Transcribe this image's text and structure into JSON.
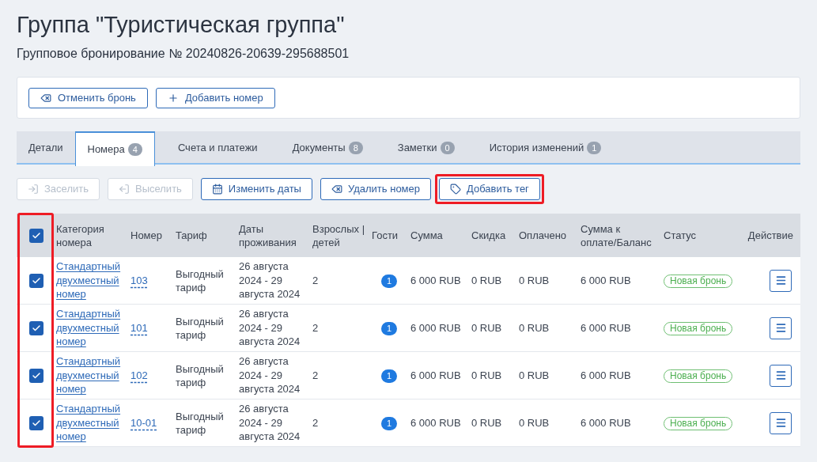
{
  "title": "Группа \"Туристическая группа\"",
  "subtitle": "Групповое бронирование № 20240826-20639-295688501",
  "actions": [
    {
      "label": "Отменить бронь"
    },
    {
      "label": "Добавить номер"
    }
  ],
  "tabs": [
    {
      "label": "Детали",
      "selected": false
    },
    {
      "label": "Номера",
      "count": "4",
      "selected": true
    },
    {
      "label": "Счета и платежи",
      "selected": false
    },
    {
      "label": "Документы",
      "count": "8",
      "selected": false
    },
    {
      "label": "Заметки",
      "count": "0",
      "selected": false
    },
    {
      "label": "История изменений",
      "count": "1",
      "selected": false
    }
  ],
  "toolbar": [
    {
      "label": "Заселить",
      "disabled": true,
      "highlighted": false
    },
    {
      "label": "Выселить",
      "disabled": true,
      "highlighted": false
    },
    {
      "label": "Изменить даты",
      "disabled": false,
      "highlighted": false
    },
    {
      "label": "Удалить номер",
      "disabled": false,
      "highlighted": false
    },
    {
      "label": "Добавить тег",
      "disabled": false,
      "highlighted": true
    }
  ],
  "table": {
    "select_all": {
      "checked": true
    },
    "checkbox_column_highlighted": true,
    "columns": [
      "Категория номера",
      "Номер",
      "Тариф",
      "Даты проживания",
      "Взрослых | детей",
      "Гости",
      "Сумма",
      "Скидка",
      "Оплачено",
      "Сумма к оплате/Баланс",
      "Статус",
      "Действие"
    ],
    "rows": [
      {
        "checked": true,
        "category": "Стандартный двухместный номер",
        "number": "103",
        "tariff": "Выгодный тариф",
        "dates": "26 августа 2024 - 29 августа 2024",
        "adults": "2",
        "guests": "1",
        "sum": "6 000 RUB",
        "discount": "0 RUB",
        "paid": "0 RUB",
        "balance": "6 000 RUB",
        "status": "Новая бронь"
      },
      {
        "checked": true,
        "category": "Стандартный двухместный номер",
        "number": "101",
        "tariff": "Выгодный тариф",
        "dates": "26 августа 2024 - 29 августа 2024",
        "adults": "2",
        "guests": "1",
        "sum": "6 000 RUB",
        "discount": "0 RUB",
        "paid": "0 RUB",
        "balance": "6 000 RUB",
        "status": "Новая бронь"
      },
      {
        "checked": true,
        "category": "Стандартный двухместный номер",
        "number": "102",
        "tariff": "Выгодный тариф",
        "dates": "26 августа 2024 - 29 августа 2024",
        "adults": "2",
        "guests": "1",
        "sum": "6 000 RUB",
        "discount": "0 RUB",
        "paid": "0 RUB",
        "balance": "6 000 RUB",
        "status": "Новая бронь"
      },
      {
        "checked": true,
        "category": "Стандартный двухместный номер",
        "number": "10-01",
        "tariff": "Выгодный тариф",
        "dates": "26 августа 2024 - 29 августа 2024",
        "adults": "2",
        "guests": "1",
        "sum": "6 000 RUB",
        "discount": "0 RUB",
        "paid": "0 RUB",
        "balance": "6 000 RUB",
        "status": "Новая бронь"
      }
    ]
  }
}
